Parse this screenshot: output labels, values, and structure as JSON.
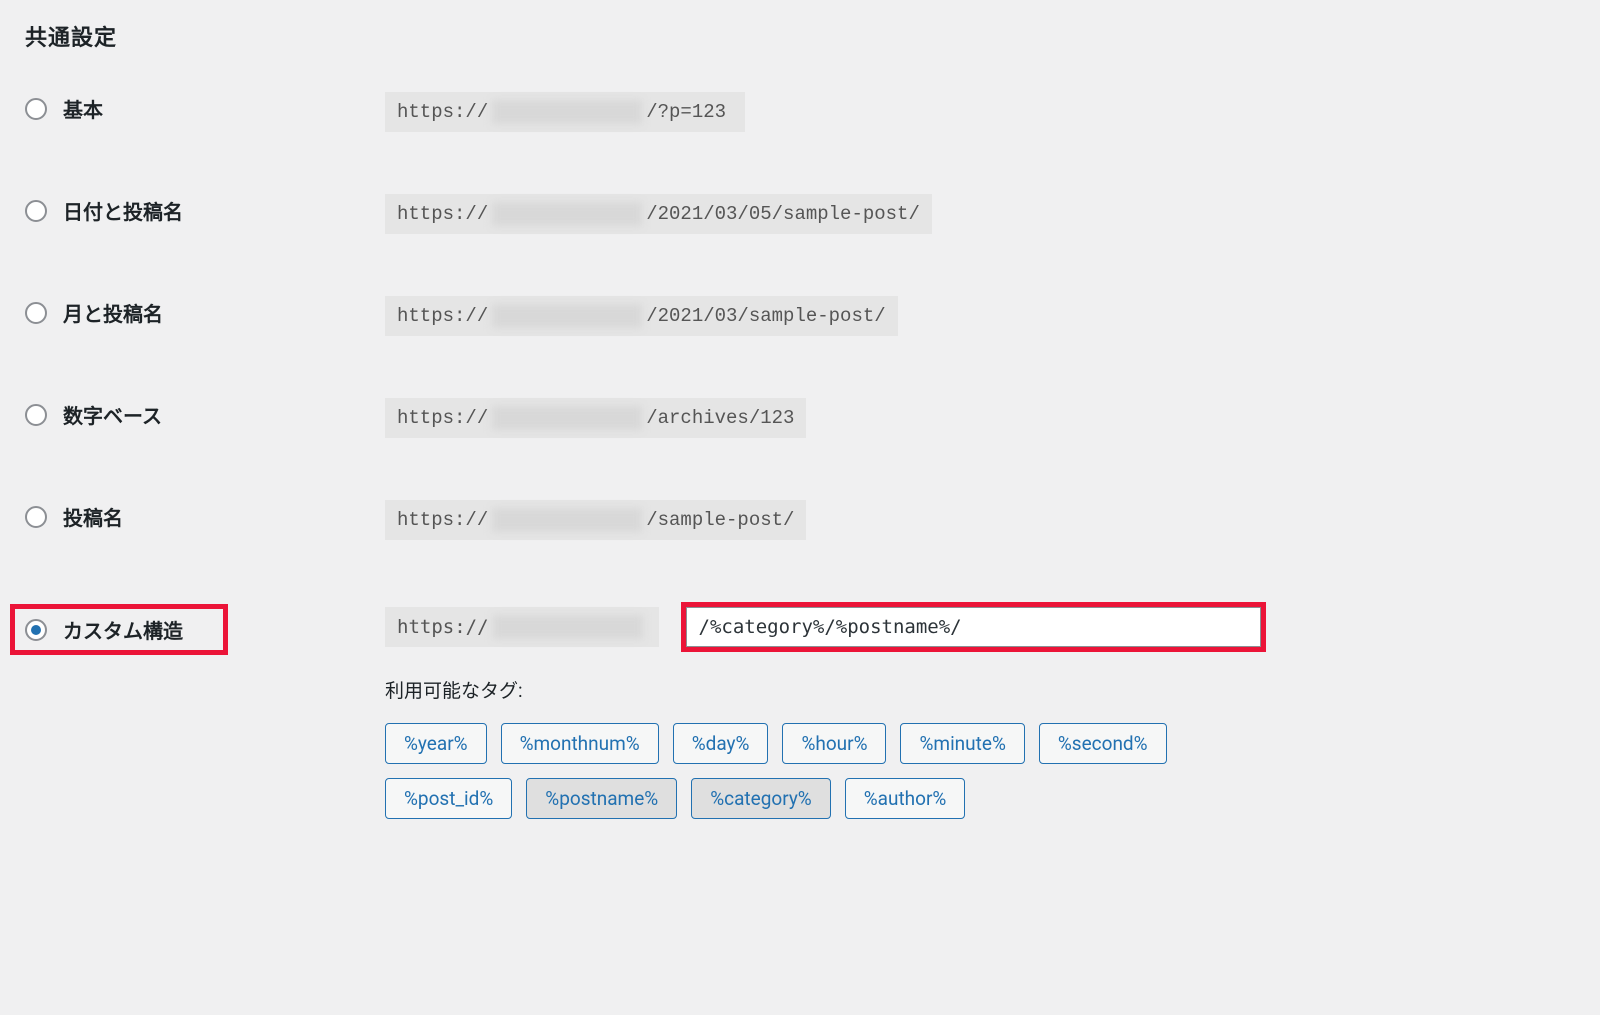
{
  "section_title": "共通設定",
  "options": [
    {
      "key": "basic",
      "label": "基本",
      "url_prefix": "https://",
      "url_suffix": "/?p=123",
      "checked": false
    },
    {
      "key": "day_name",
      "label": "日付と投稿名",
      "url_prefix": "https://",
      "url_suffix": "/2021/03/05/sample-post/",
      "checked": false
    },
    {
      "key": "month_name",
      "label": "月と投稿名",
      "url_prefix": "https://",
      "url_suffix": "/2021/03/sample-post/",
      "checked": false
    },
    {
      "key": "numeric",
      "label": "数字ベース",
      "url_prefix": "https://",
      "url_suffix": "/archives/123",
      "checked": false
    },
    {
      "key": "post_name",
      "label": "投稿名",
      "url_prefix": "https://",
      "url_suffix": "/sample-post/",
      "checked": false
    }
  ],
  "custom": {
    "label": "カスタム構造",
    "checked": true,
    "url_prefix": "https://",
    "input_value": "/%category%/%postname%/",
    "available_tags_label": "利用可能なタグ:",
    "tags": [
      {
        "label": "%year%",
        "active": false
      },
      {
        "label": "%monthnum%",
        "active": false
      },
      {
        "label": "%day%",
        "active": false
      },
      {
        "label": "%hour%",
        "active": false
      },
      {
        "label": "%minute%",
        "active": false
      },
      {
        "label": "%second%",
        "active": false
      },
      {
        "label": "%post_id%",
        "active": false
      },
      {
        "label": "%postname%",
        "active": true
      },
      {
        "label": "%category%",
        "active": true
      },
      {
        "label": "%author%",
        "active": false
      }
    ]
  },
  "colors": {
    "highlight_border": "#eb1438",
    "link_blue": "#2271b1",
    "page_bg": "#f0f0f1"
  }
}
